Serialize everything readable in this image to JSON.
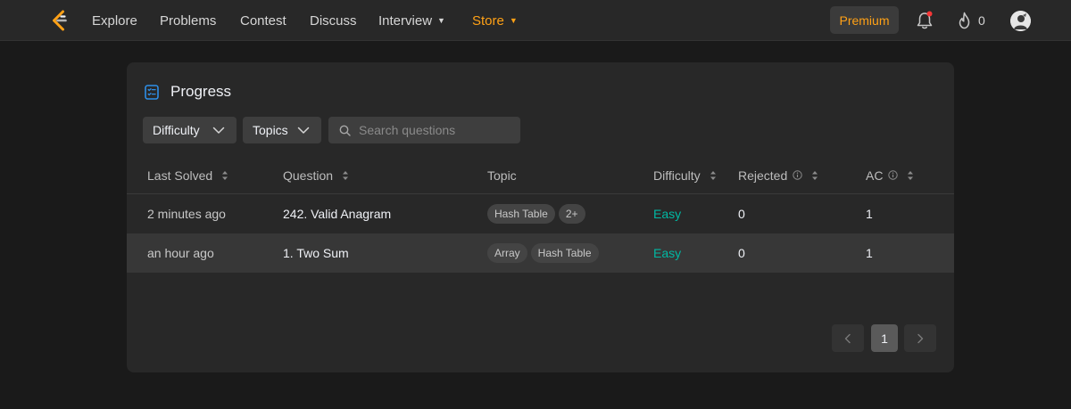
{
  "nav": {
    "items": [
      {
        "label": "Explore"
      },
      {
        "label": "Problems"
      },
      {
        "label": "Contest"
      },
      {
        "label": "Discuss"
      },
      {
        "label": "Interview",
        "dropdown": true
      },
      {
        "label": "Store",
        "dropdown": true,
        "accent": "#ffa116"
      }
    ],
    "premium_label": "Premium",
    "streak_count": "0",
    "notification_dot_color": "#f63636"
  },
  "panel": {
    "title": "Progress",
    "filters": {
      "difficulty_label": "Difficulty",
      "topics_label": "Topics",
      "search_placeholder": "Search questions",
      "search_value": ""
    },
    "columns": {
      "last_solved": "Last Solved",
      "question": "Question",
      "topic": "Topic",
      "difficulty": "Difficulty",
      "rejected": "Rejected",
      "ac": "AC"
    },
    "rows": [
      {
        "last_solved": "2 minutes ago",
        "question": "242. Valid Anagram",
        "tags": [
          "Hash Table",
          "2+"
        ],
        "difficulty": "Easy",
        "rejected": "0",
        "ac": "1"
      },
      {
        "last_solved": "an hour ago",
        "question": "1. Two Sum",
        "tags": [
          "Array",
          "Hash Table"
        ],
        "difficulty": "Easy",
        "rejected": "0",
        "ac": "1"
      }
    ],
    "pagination": {
      "current_page": "1"
    }
  },
  "colors": {
    "accent": "#ffa116",
    "easy": "#00b8a3",
    "progress_icon": "#2e8fe8"
  }
}
